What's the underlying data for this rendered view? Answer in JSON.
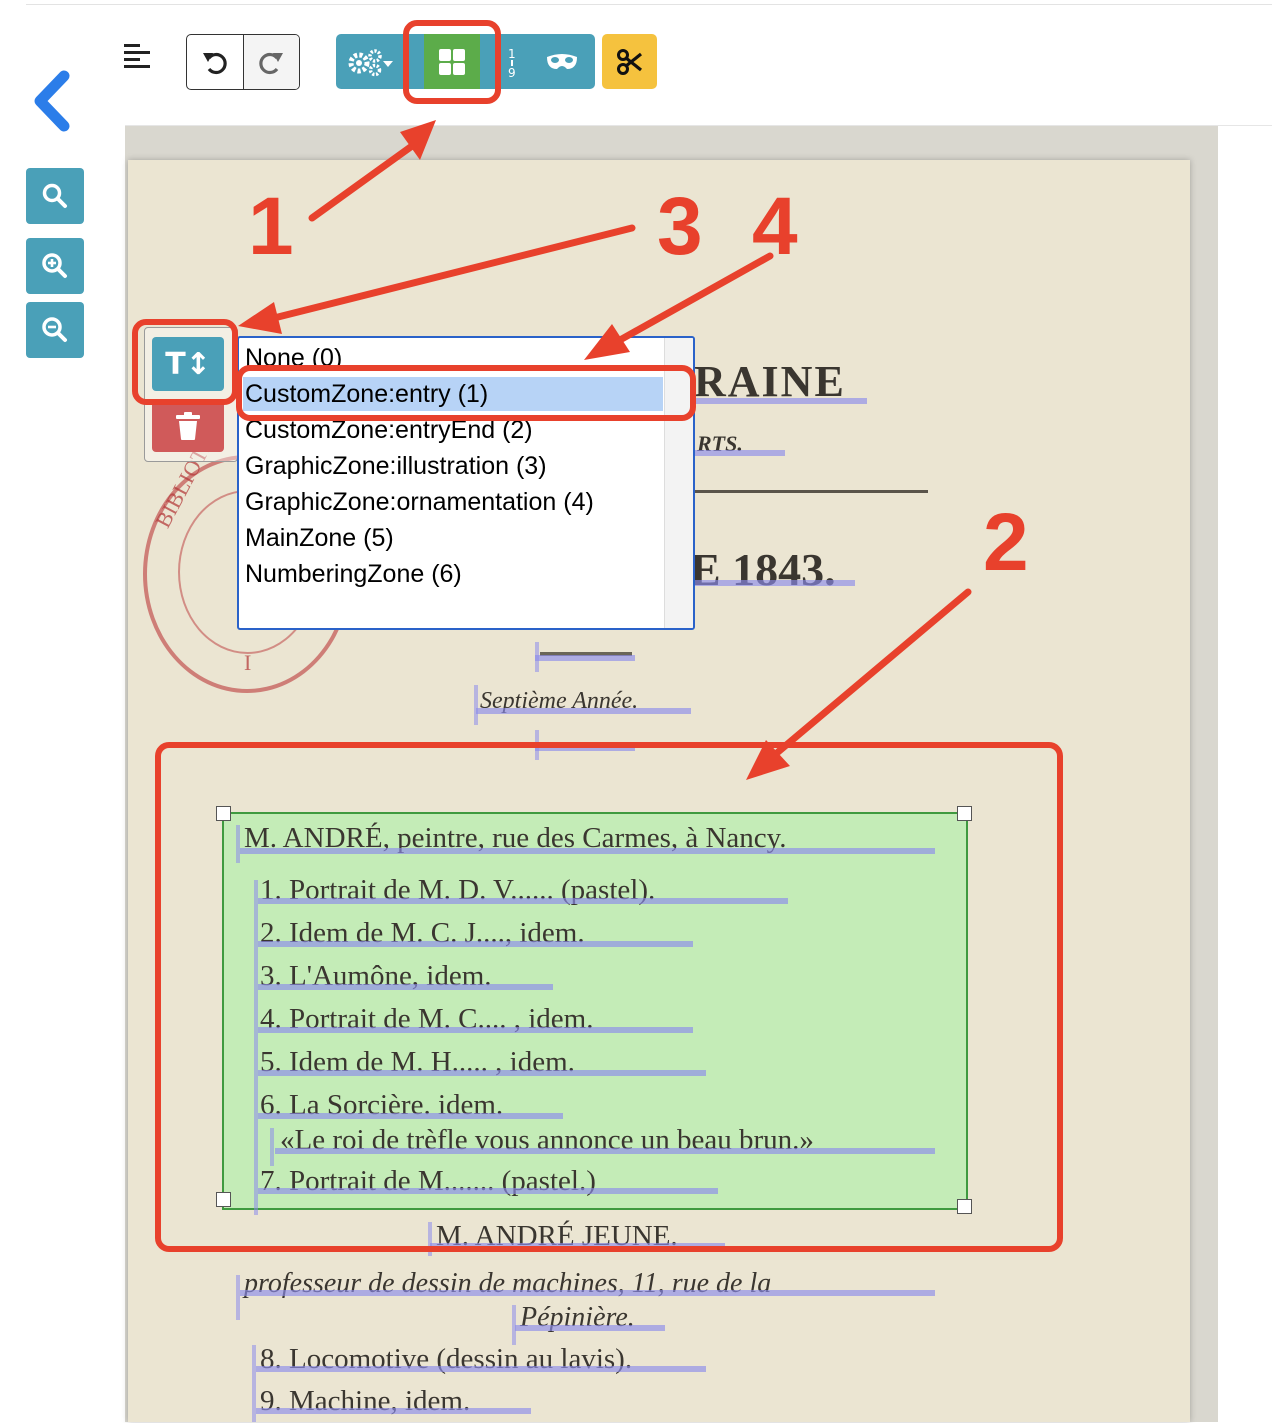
{
  "toolbar": {
    "menu_icon": "align-left-icon",
    "undo_icon": "undo-icon",
    "redo_icon": "redo-icon",
    "settings_icon": "cogs-dropdown-icon",
    "layout_icon": "grid-icon",
    "ordering_icon": "ordering-icon",
    "mask_icon": "mask-icon",
    "cut_icon": "scissors-icon"
  },
  "left_controls": {
    "back_icon": "chevron-left-icon",
    "search_icon": "search-icon",
    "zoom_in_icon": "zoom-in-icon",
    "zoom_out_icon": "zoom-out-icon"
  },
  "zone_popup": {
    "type_button_label": "T↕",
    "delete_icon": "trash-icon",
    "options": [
      "None (0)",
      "CustomZone:entry (1)",
      "CustomZone:entryEnd (2)",
      "GraphicZone:illustration (3)",
      "GraphicZone:ornamentation (4)",
      "MainZone (5)",
      "NumberingZone (6)"
    ],
    "selected": "CustomZone:entry (1)"
  },
  "document": {
    "header_fragment": "RAINE",
    "subheader_fragment": "RTS.",
    "year_fragment": "E 1843.",
    "edition": "Septième Année.",
    "entry_lines": [
      "M. ANDRÉ, peintre, rue des Carmes, à Nancy.",
      "1. Portrait de M. D. V...... (pastel).",
      "2. Idem de M. C. J...., idem.",
      "3. L'Aumône, idem.",
      "4. Portrait de M. C.... , idem.",
      "5.  Idem  de M. H..... , idem.",
      "6. La Sorcière. idem.",
      "«Le roi de trèfle vous annonce un beau  brun.»",
      "7. Portrait de M....... (pastel.)"
    ],
    "next_heading": "M. ANDRÉ JEUNE.",
    "next_lines": [
      "professeur de dessin de machines, 11, rue de la",
      "Pépinière.",
      "8. Locomotive (dessin  au lavis).",
      "9. Machine, idem."
    ],
    "stamp_text": "BIBLIOTHE",
    "stamp_mark": "I"
  },
  "annotations": {
    "labels": [
      "1",
      "2",
      "3",
      "4"
    ],
    "color": "#e8412c"
  },
  "colors": {
    "teal": "#4aa0b8",
    "green": "#5cac4a",
    "yellow": "#f5c23e",
    "red_button": "#d05a5a",
    "back_blue": "#2b7de9"
  }
}
